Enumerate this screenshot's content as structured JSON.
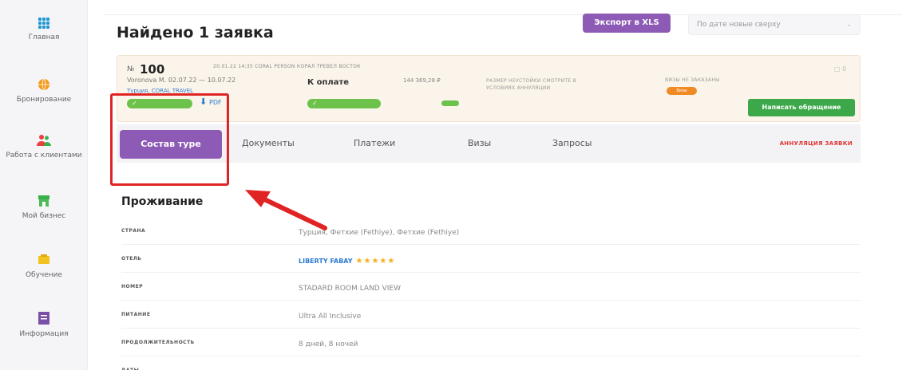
{
  "sidebar": {
    "items": [
      {
        "label": "Главная",
        "icon": "grid-icon"
      },
      {
        "label": "Бронирование",
        "icon": "globe-icon"
      },
      {
        "label": "Работа с клиентами",
        "icon": "users-icon"
      },
      {
        "label": "Мой бизнес",
        "icon": "store-icon"
      },
      {
        "label": "Обучение",
        "icon": "education-icon"
      },
      {
        "label": "Информация",
        "icon": "info-icon"
      }
    ]
  },
  "header": {
    "title": "Найдено 1 заявка",
    "export_label": "Экспорт в XLS",
    "sort_value": "По дате новые сверху",
    "sort_chevron": "⌄"
  },
  "order": {
    "number_label": "№",
    "number": "100",
    "meta": "20.01.22 14:35   CORAL PERSON   КОРАЛ ТРЕВЕЛ ВОСТОК",
    "person_dates": "Voronova M.   02.07.22 — 10.07.22",
    "tour_link": "Турция, CORAL TRAVEL",
    "pill_check": "✓",
    "pdf_label": "PDF",
    "payment_label": "К оплате",
    "payment_sum": "144 369,28 ₽",
    "payment_check": "✓",
    "penalty_text": "РАЗМЕР НЕУСТОЙКИ СМОТРИТЕ В УСЛОВИЯХ АННУЛЯЦИИ",
    "visa_label": "ВИЗЫ НЕ ЗАКАЗАНЫ",
    "visa_badge": "Визы",
    "corner_text": "□ 0",
    "write_button": "Написать обращение"
  },
  "tabs": {
    "active": "Состав туре",
    "items": [
      "Документы",
      "Платежи",
      "Визы",
      "Запросы"
    ],
    "annul": "АННУЛЯЦИЯ ЗАЯВКИ"
  },
  "accommodation": {
    "title": "Проживание",
    "rows": [
      {
        "key": "СТРАНА",
        "value": "Турция, Фетхие (Fethiye), Фетхие (Fethiye)"
      },
      {
        "key": "ОТЕЛЬ",
        "value": "LIBERTY FABAY",
        "stars": "★★★★★"
      },
      {
        "key": "НОМЕР",
        "value": "STADARD ROOM LAND VIEW"
      },
      {
        "key": "ПИТАНИЕ",
        "value": "Ultra All Inclusive"
      },
      {
        "key": "ПРОДОЛЖИТЕЛЬНОСТЬ",
        "value": "8 дней, 8 ночей"
      },
      {
        "key": "ДАТЫ",
        "value": ""
      }
    ]
  },
  "colors": {
    "accent_purple": "#8d5bb5",
    "green": "#6cc24a",
    "highlight_red": "#e02424",
    "card_bg": "#fbf4ea"
  }
}
